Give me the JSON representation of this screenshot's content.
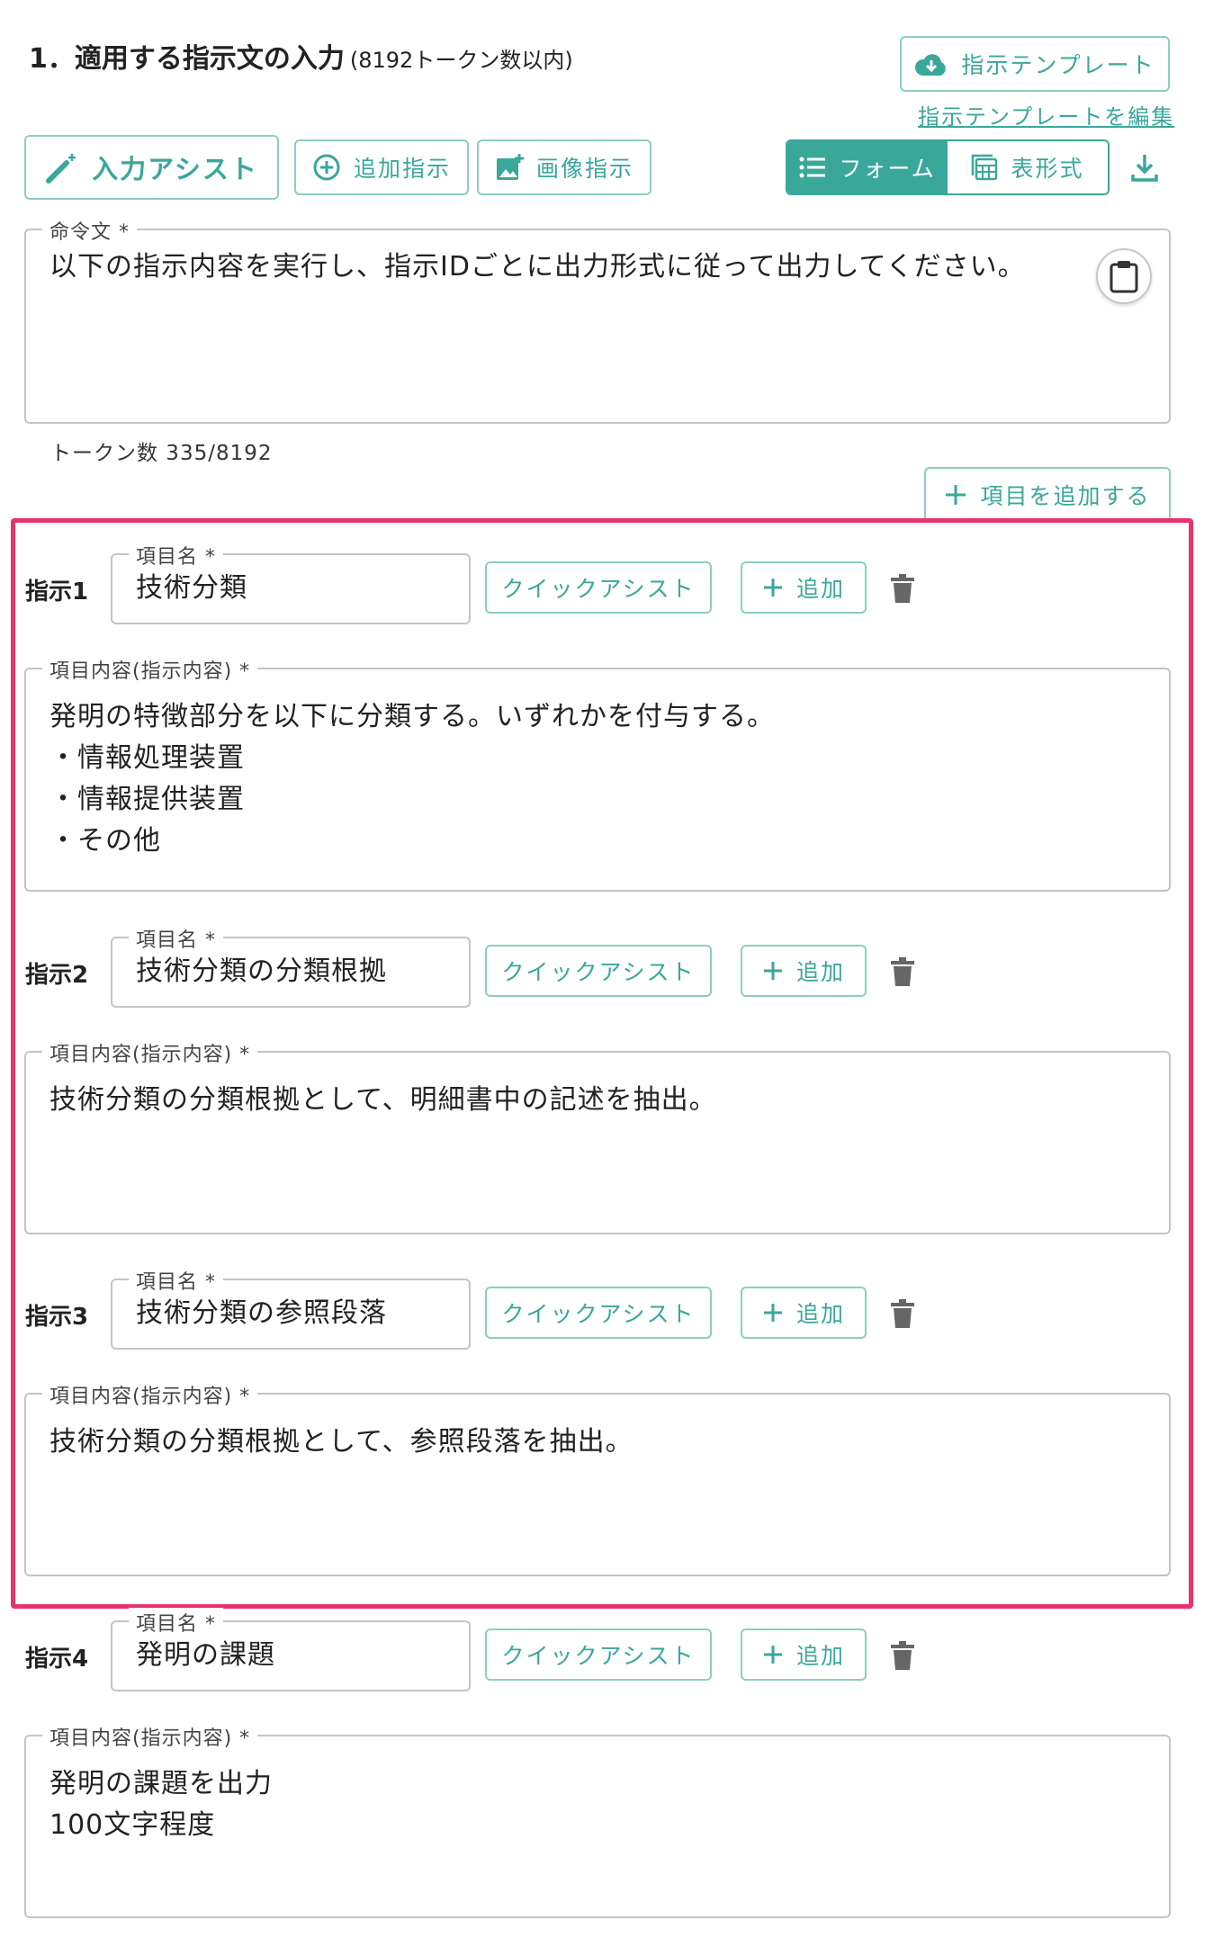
{
  "section": {
    "title": "1．適用する指示文の入力",
    "subtitle": "(8192トークン数以内)"
  },
  "header": {
    "template_button": "指示テンプレート",
    "edit_template_link": "指示テンプレートを編集"
  },
  "toolbar": {
    "input_assist": "入力アシスト",
    "add_instruction": "追加指示",
    "image_instruction": "画像指示",
    "form_tab": "フォーム",
    "table_tab": "表形式",
    "active_tab": "フォーム"
  },
  "command": {
    "legend": "命令文 *",
    "value": "以下の指示内容を実行し、指示IDごとに出力形式に従って出力してください。",
    "token_count": "トークン数 335/8192"
  },
  "add_item_button": "項目を追加する",
  "instructions": [
    {
      "label": "指示1",
      "name_legend": "項目名 *",
      "name": "技術分類",
      "quick_assist": "クイックアシスト",
      "add": "追加",
      "content_legend": "項目内容(指示内容) *",
      "content": "発明の特徴部分を以下に分類する。いずれかを付与する。\n・情報処理装置\n・情報提供装置\n・その他"
    },
    {
      "label": "指示2",
      "name_legend": "項目名 *",
      "name": "技術分類の分類根拠",
      "quick_assist": "クイックアシスト",
      "add": "追加",
      "content_legend": "項目内容(指示内容) *",
      "content": "技術分類の分類根拠として、明細書中の記述を抽出。"
    },
    {
      "label": "指示3",
      "name_legend": "項目名 *",
      "name": "技術分類の参照段落",
      "quick_assist": "クイックアシスト",
      "add": "追加",
      "content_legend": "項目内容(指示内容) *",
      "content": "技術分類の分類根拠として、参照段落を抽出。"
    },
    {
      "label": "指示4",
      "name_legend": "項目名 *",
      "name": "発明の課題",
      "quick_assist": "クイックアシスト",
      "add": "追加",
      "content_legend": "項目内容(指示内容) *",
      "content": "発明の課題を出力\n100文字程度"
    }
  ],
  "colors": {
    "accent": "#3aa79b",
    "highlight": "#e8336d",
    "border": "#c4c4c4"
  },
  "icons": [
    "cloud-download-icon",
    "magic-wand-icon",
    "plus-circle-icon",
    "add-image-icon",
    "list-icon",
    "table-icon",
    "download-icon",
    "clipboard-icon",
    "plus-icon",
    "trash-icon"
  ]
}
